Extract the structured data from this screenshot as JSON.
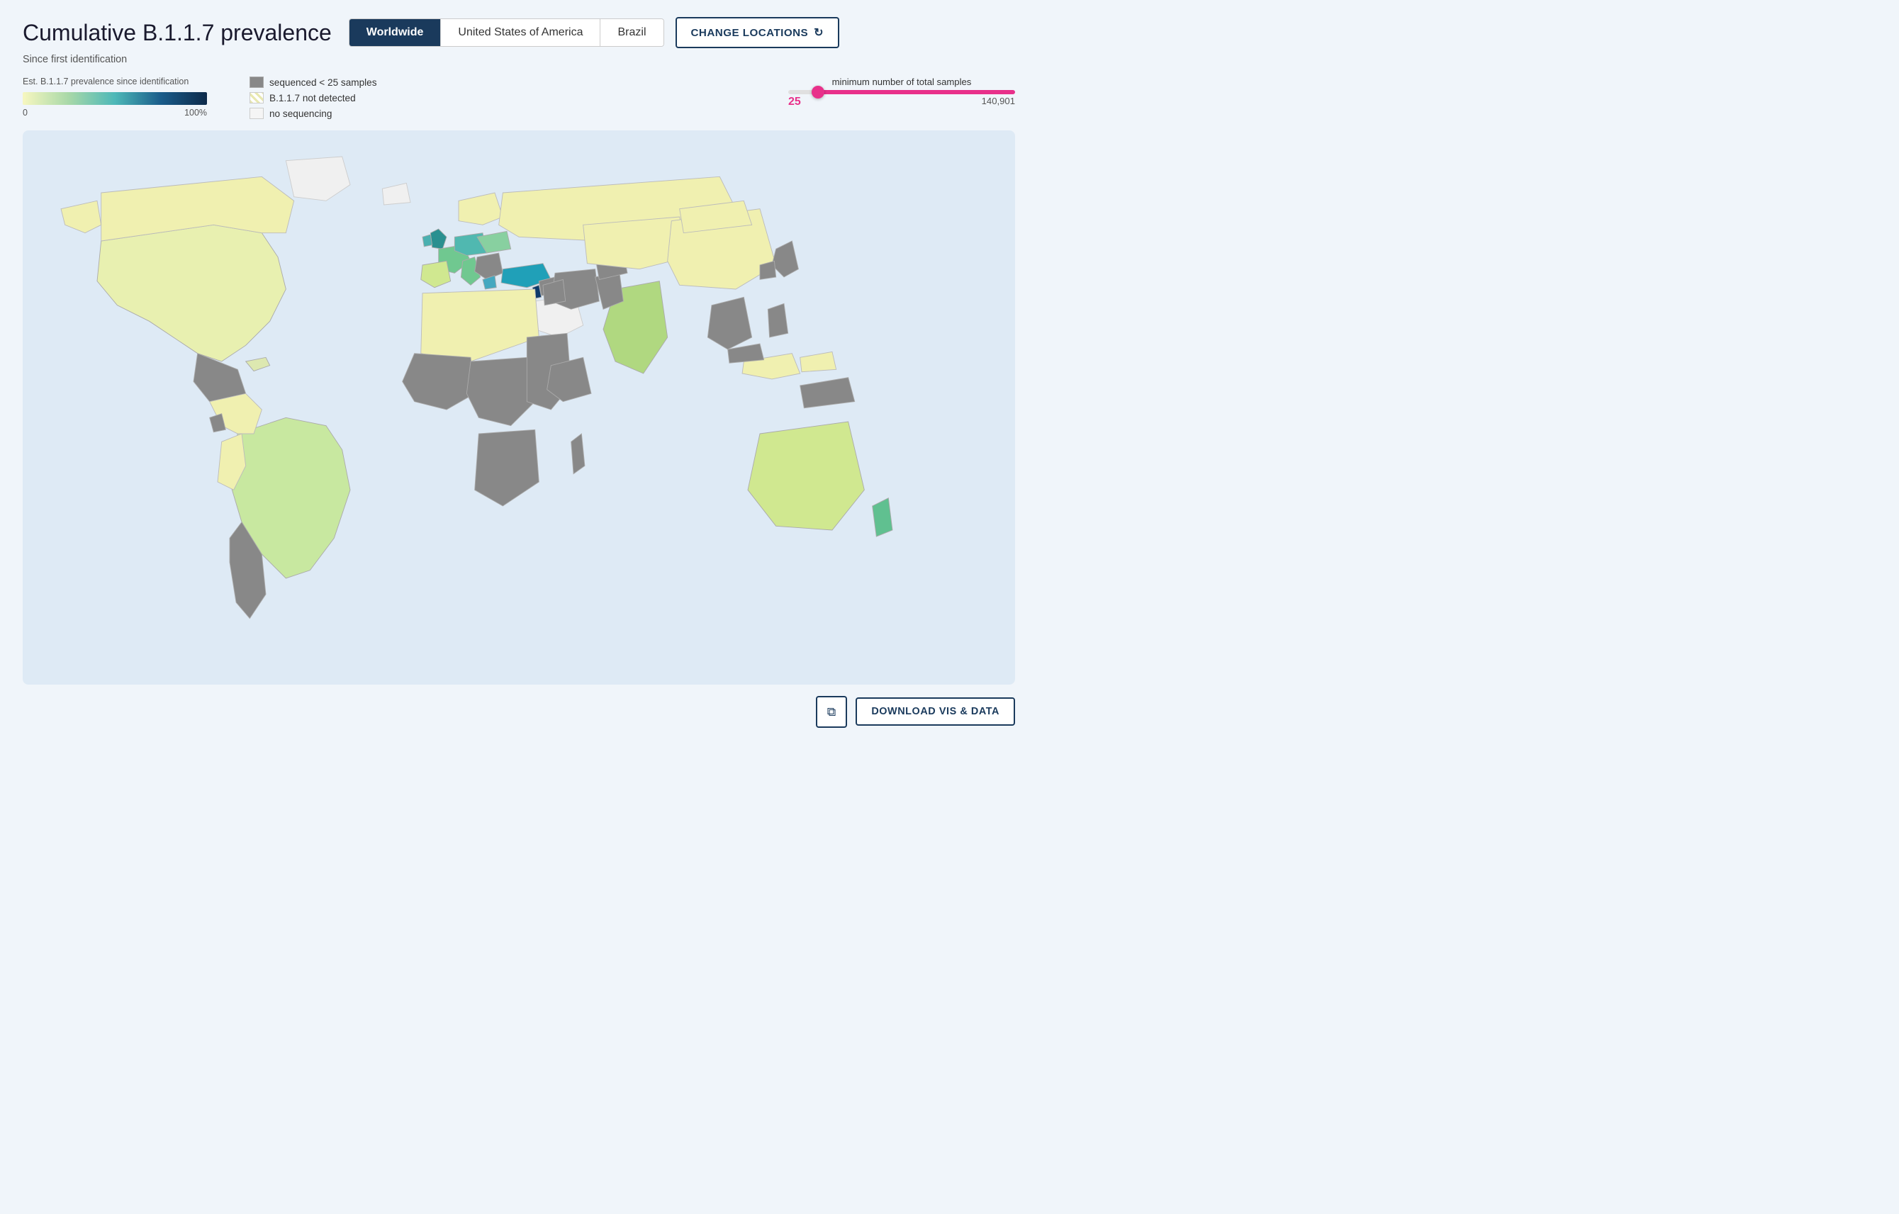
{
  "header": {
    "title": "Cumulative B.1.1.7 prevalence",
    "subtitle": "Since first identification",
    "tabs": [
      {
        "label": "Worldwide",
        "active": true
      },
      {
        "label": "United States of America",
        "active": false
      },
      {
        "label": "Brazil",
        "active": false
      }
    ],
    "change_locations_label": "CHANGE LOCATIONS"
  },
  "legend": {
    "gradient_label": "Est. B.1.1.7 prevalence since identification",
    "gradient_min": "0",
    "gradient_max": "100%",
    "items": [
      {
        "label": "sequenced < 25 samples",
        "type": "gray"
      },
      {
        "label": "B.1.1.7 not detected",
        "type": "hatch"
      },
      {
        "label": "no sequencing",
        "type": "white"
      }
    ]
  },
  "slider": {
    "label": "minimum number of total samples",
    "min_value": "25",
    "max_value": "140,901",
    "current_value": 25,
    "max_raw": 140901
  },
  "footer": {
    "download_label": "DOWNLOAD VIS & DATA",
    "copy_label": "⧉"
  }
}
